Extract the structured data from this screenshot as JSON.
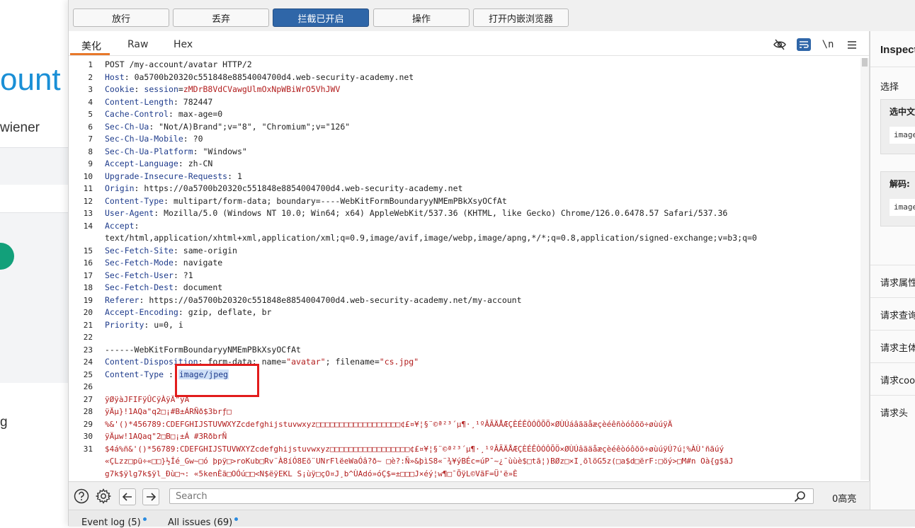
{
  "background_page": {
    "title_fragment": "ount",
    "user_fragment": "wiener",
    "bottom_fragment": "g"
  },
  "toolbar": {
    "forward": "放行",
    "drop": "丢弃",
    "intercept": "拦截已开启",
    "action": "操作",
    "open_browser": "打开内嵌浏览器"
  },
  "editor": {
    "tabs": [
      "美化",
      "Raw",
      "Hex"
    ],
    "active_tab": "美化",
    "newline_toggle": "\\n"
  },
  "request": {
    "lines": [
      {
        "n": "1",
        "name": "",
        "value": "POST /my-account/avatar HTTP/2"
      },
      {
        "n": "2",
        "name": "Host",
        "value": " 0a5700b20320c551848e8854004700d4.web-security-academy.net"
      },
      {
        "n": "3",
        "name": "Cookie",
        "value": ""
      },
      {
        "n": "4",
        "name": "Content-Length",
        "value": " 782447"
      },
      {
        "n": "5",
        "name": "Cache-Control",
        "value": " max-age=0"
      },
      {
        "n": "6",
        "name": "Sec-Ch-Ua",
        "value": " \"Not/A)Brand\";v=\"8\", \"Chromium\";v=\"126\""
      },
      {
        "n": "7",
        "name": "Sec-Ch-Ua-Mobile",
        "value": " ?0"
      },
      {
        "n": "8",
        "name": "Sec-Ch-Ua-Platform",
        "value": " \"Windows\""
      },
      {
        "n": "9",
        "name": "Accept-Language",
        "value": " zh-CN"
      },
      {
        "n": "10",
        "name": "Upgrade-Insecure-Requests",
        "value": " 1"
      },
      {
        "n": "11",
        "name": "Origin",
        "value": " https://0a5700b20320c551848e8854004700d4.web-security-academy.net"
      },
      {
        "n": "12",
        "name": "Content-Type",
        "value": " multipart/form-data; boundary=----WebKitFormBoundaryyNMEmPBkXsyOCfAt"
      },
      {
        "n": "13",
        "name": "User-Agent",
        "value": " Mozilla/5.0 (Windows NT 10.0; Win64; x64) AppleWebKit/537.36 (KHTML, like Gecko) Chrome/126.0.6478.57 Safari/537.36"
      },
      {
        "n": "14",
        "name": "Accept",
        "value": ""
      },
      {
        "n": "",
        "name": "",
        "value": "text/html,application/xhtml+xml,application/xml;q=0.9,image/avif,image/webp,image/apng,*/*;q=0.8,application/signed-exchange;v=b3;q=0"
      },
      {
        "n": "15",
        "name": "Sec-Fetch-Site",
        "value": " same-origin"
      },
      {
        "n": "16",
        "name": "Sec-Fetch-Mode",
        "value": " navigate"
      },
      {
        "n": "17",
        "name": "Sec-Fetch-User",
        "value": " ?1"
      },
      {
        "n": "18",
        "name": "Sec-Fetch-Dest",
        "value": " document"
      },
      {
        "n": "19",
        "name": "Referer",
        "value": " https://0a5700b20320c551848e8854004700d4.web-security-academy.net/my-account"
      },
      {
        "n": "20",
        "name": "Accept-Encoding",
        "value": " gzip, deflate, br"
      },
      {
        "n": "21",
        "name": "Priority",
        "value": " u=0, i"
      },
      {
        "n": "22",
        "name": "",
        "value": ""
      },
      {
        "n": "23",
        "name": "",
        "value": "------WebKitFormBoundaryyNMEmPBkXsyOCfAt"
      },
      {
        "n": "24",
        "name": "Content-Disposition",
        "value": ""
      },
      {
        "n": "25",
        "name": "Content-Type",
        "value": ""
      },
      {
        "n": "26",
        "name": "",
        "value": ""
      }
    ],
    "cookie_name": "session",
    "cookie_value": "zMDrB8VdCVawgUlmOxNpWBiWrO5VhJWV",
    "disposition_prefix": " form-data; name=",
    "disposition_field": "\"avatar\"",
    "disposition_mid": "; filename=",
    "disposition_file": "\"cs.jpg\"",
    "content_type_prefix": " : ",
    "content_type_selected": "image/jpeg",
    "binary_lines": [
      {
        "n": "27",
        "text": "ÿØÿàJFIFÿÛCÿÀÿÄ\"ÿÄ"
      },
      {
        "n": "28",
        "text": "ÿÄµ}!1AQa\"q2□¡#B±ÁRÑð$3brƒ□"
      },
      {
        "n": "29",
        "text": "%&'()*456789:CDEFGHIJSTUVWXYZcdefghijstuvwxyz□□□□□□□□□□□□□□□□□□¢£¤¥¦§¨©ª²³´µ¶·¸¹ºÂÃÄÅÆÇÈÉÊÒÓÔÕÖ×ØÙÚáâãäåæçèéêñòóôõö÷øùúÿÄ"
      },
      {
        "n": "30",
        "text": "ÿÄµw!1AQaq\"2□B□¡±Á  #3RðbrÑ"
      },
      {
        "n": "31",
        "text": "$4á%ñ&'()*56789:CDEFGHIJSTUVWXYZcdefghijstuvwxyz□□□□□□□□□□□□□□□□□¢£¤¥¦§¨©ª²³´µ¶·¸¹ºÂÃÄÅÆÇÈÉÊÒÓÔÕÖ×ØÙÚâãäåæçèéêòóôõö÷øùúÿÚ?ú¦%ÀÙ'ñãúý"
      },
      {
        "n": "",
        "text": "«ÇLzz□pü÷«□□}½Íé_Gw~□ó þpÿ□>roKub□Rv¨À8íÓ8Eõ¨UNrFlëeWaÓâ?ð~ □è?:Ñ»&þìS8«¨¾¥ýBÉc=úP¯~¿¯ùùè$□tã¦)BØz□×I¸õlõG5z(□a$d□ërF:□öý>□M#n Oà{g$ãJ"
      },
      {
        "n": "",
        "text": "g7k$ÿlg7k$ÿl_Ðù□¬: «5kenÈã□OÓú□□<N$ëÿEKL S¡ùÿ□çO¤J¸b^ÙAdó»óÇ$=±□□□J×éý¦w¶□¯ÕÿL©VãF=Ü'ë»È"
      }
    ]
  },
  "search": {
    "placeholder": "Search",
    "match_count": "0高亮"
  },
  "status": {
    "event_log": "Event log (5)",
    "all_issues": "All issues (69)"
  },
  "inspector": {
    "title": "Inspector",
    "selection": "选择",
    "selected_text_header": "选中文本",
    "selected_text_value": "image/jpeg",
    "decoded_header": "解码:",
    "decoded_value": "image/jpeg",
    "sections": [
      "请求属性",
      "请求查询参数",
      "请求主体参数",
      "请求cookie",
      "请求头"
    ]
  },
  "colors": {
    "accent_blue": "#2f66a8",
    "tab_underline": "#e8782a",
    "header_name": "#1f3c8c",
    "cookie_red": "#b21d1d",
    "highlight_box": "#e21c1c"
  }
}
